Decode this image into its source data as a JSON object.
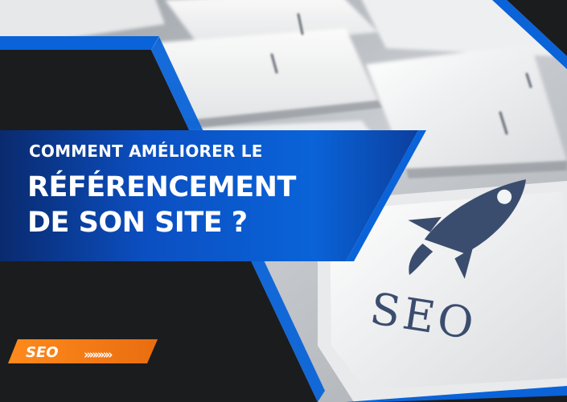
{
  "banner": {
    "line1": "COMMENT AMÉLIORER LE",
    "line2": "RÉFÉRENCEMENT",
    "line3": "DE SON SITE ?"
  },
  "tag": {
    "label": "SEO",
    "chevrons": "»»»»»"
  },
  "key": {
    "label": "SEO",
    "icon": "rocket-icon"
  },
  "colors": {
    "brand_blue": "#0a63d8",
    "dark_bg": "#1b1c1e",
    "tag_orange": "#f07f1a",
    "key_print": "#3b4d6e"
  }
}
